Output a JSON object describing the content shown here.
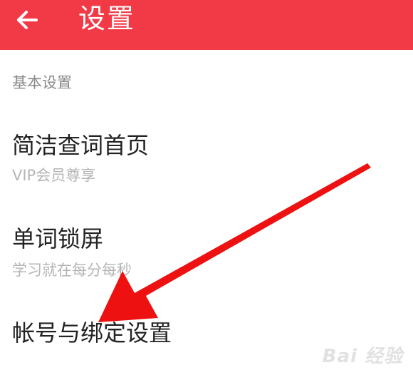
{
  "header": {
    "title": "设置",
    "back_icon": "arrow-left-icon",
    "background_color": "#f23a47"
  },
  "section": {
    "label": "基本设置"
  },
  "items": [
    {
      "title": "简洁查词首页",
      "subtitle": "VIP会员尊享"
    },
    {
      "title": "单词锁屏",
      "subtitle": "学习就在每分每秒"
    },
    {
      "title": "帐号与绑定设置",
      "subtitle": ""
    }
  ],
  "annotation": {
    "arrow_color": "#ee1111"
  },
  "watermark": {
    "text": "Bai 经验"
  }
}
